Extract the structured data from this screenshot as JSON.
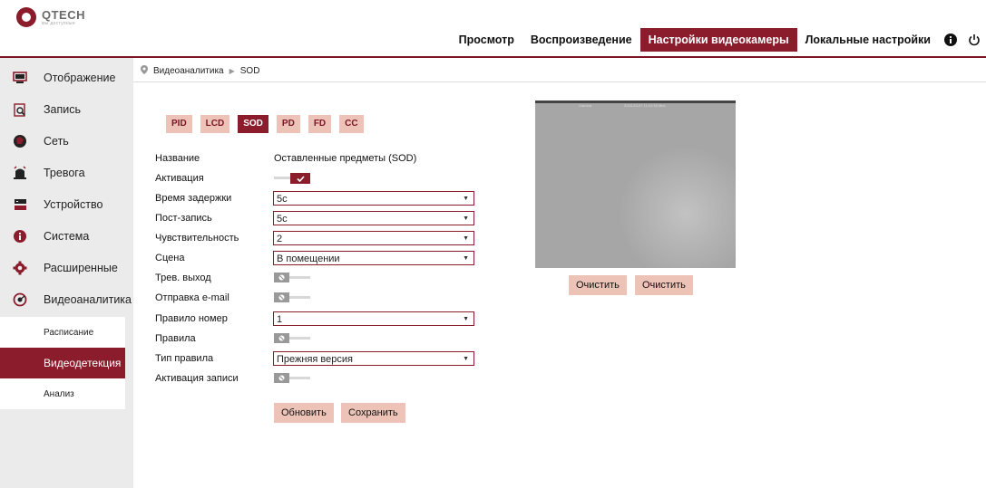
{
  "brand": {
    "name": "QTECH",
    "tagline": "мы доступные"
  },
  "topnav": {
    "items": [
      {
        "label": "Просмотр",
        "active": false
      },
      {
        "label": "Воспроизведение",
        "active": false
      },
      {
        "label": "Настройки видеокамеры",
        "active": true
      },
      {
        "label": "Локальные настройки",
        "active": false
      }
    ],
    "icons": [
      "info-icon",
      "power-icon"
    ]
  },
  "colors": {
    "accent": "#8b1c2b",
    "tab_bg": "#ecc3b6",
    "sidebar_bg": "#ebebeb"
  },
  "sidebar": {
    "items": [
      {
        "label": "Отображение",
        "icon": "monitor-icon"
      },
      {
        "label": "Запись",
        "icon": "record-icon"
      },
      {
        "label": "Сеть",
        "icon": "network-icon"
      },
      {
        "label": "Тревога",
        "icon": "alarm-icon"
      },
      {
        "label": "Устройство",
        "icon": "device-icon"
      },
      {
        "label": "Система",
        "icon": "info-icon"
      },
      {
        "label": "Расширенные",
        "icon": "gear-icon"
      },
      {
        "label": "Видеоаналитика",
        "icon": "analytics-icon"
      }
    ],
    "subitems": [
      {
        "label": "Расписание",
        "active": false
      },
      {
        "label": "Видеодетекция",
        "active": true
      },
      {
        "label": "Анализ",
        "active": false
      }
    ]
  },
  "breadcrumb": {
    "section": "Видеоаналитика",
    "page": "SOD"
  },
  "tabs": [
    {
      "label": "PID",
      "active": false
    },
    {
      "label": "LCD",
      "active": false
    },
    {
      "label": "SOD",
      "active": true
    },
    {
      "label": "PD",
      "active": false
    },
    {
      "label": "FD",
      "active": false
    },
    {
      "label": "CC",
      "active": false
    }
  ],
  "form": {
    "name": {
      "label": "Название",
      "value": "Оставленные предметы (SOD)"
    },
    "activation": {
      "label": "Активация",
      "on": true
    },
    "delay": {
      "label": "Время задержки",
      "value": "5с"
    },
    "post_record": {
      "label": "Пост-запись",
      "value": "5с"
    },
    "sensitivity": {
      "label": "Чувствительность",
      "value": "2"
    },
    "scene": {
      "label": "Сцена",
      "value": "В помещении"
    },
    "alarm_out": {
      "label": "Трев. выход",
      "on": false
    },
    "email": {
      "label": "Отправка e-mail",
      "on": false
    },
    "rule_number": {
      "label": "Правило номер",
      "value": "1"
    },
    "rules": {
      "label": "Правила",
      "on": false
    },
    "rule_type": {
      "label": "Тип правила",
      "value": "Прежняя версия"
    },
    "record_activation": {
      "label": "Активация записи",
      "on": false
    }
  },
  "buttons": {
    "refresh": "Обновить",
    "save": "Сохранить"
  },
  "preview": {
    "osd_left": "Camera",
    "osd_right": "2016-03-07 11:01:33 Mon",
    "clear_1": "Очистить",
    "clear_2": "Очистить"
  }
}
